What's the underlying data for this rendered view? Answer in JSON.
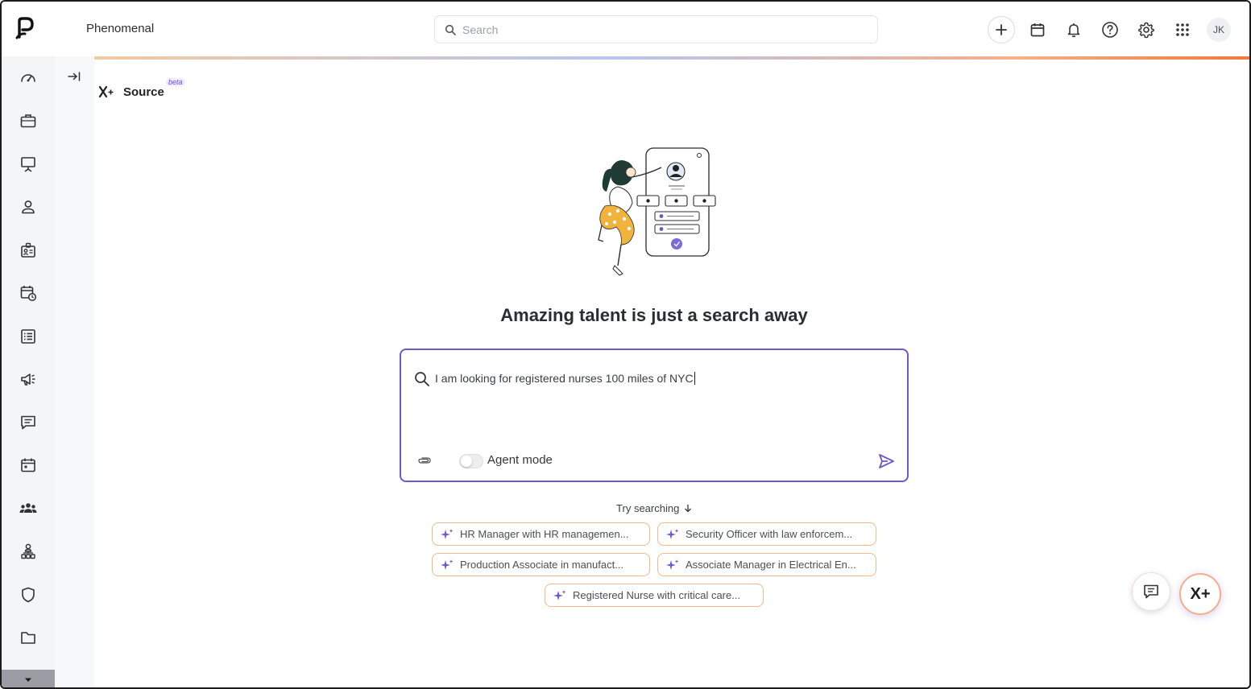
{
  "app": {
    "title": "Phenomenal"
  },
  "search": {
    "placeholder": "Search"
  },
  "user": {
    "initials": "JK"
  },
  "page": {
    "title": "Source",
    "badge": "beta"
  },
  "main": {
    "headline": "Amazing talent is just a search away",
    "prompt_text": "I am looking for registered nurses 100 miles of NYC",
    "agent_mode_label": "Agent mode",
    "agent_mode_on": false,
    "try_searching": "Try searching"
  },
  "suggestions": [
    "HR Manager with HR managemen...",
    "Security Officer with law enforcem...",
    "Production Associate in manufact...",
    "Associate Manager in Electrical En...",
    "Registered Nurse with critical care..."
  ],
  "fab": {
    "assistant_label": "X+"
  },
  "colors": {
    "accent": "#6d59c9",
    "chip_border": "#f2b98c",
    "rail_bg": "#f4f5f7"
  }
}
